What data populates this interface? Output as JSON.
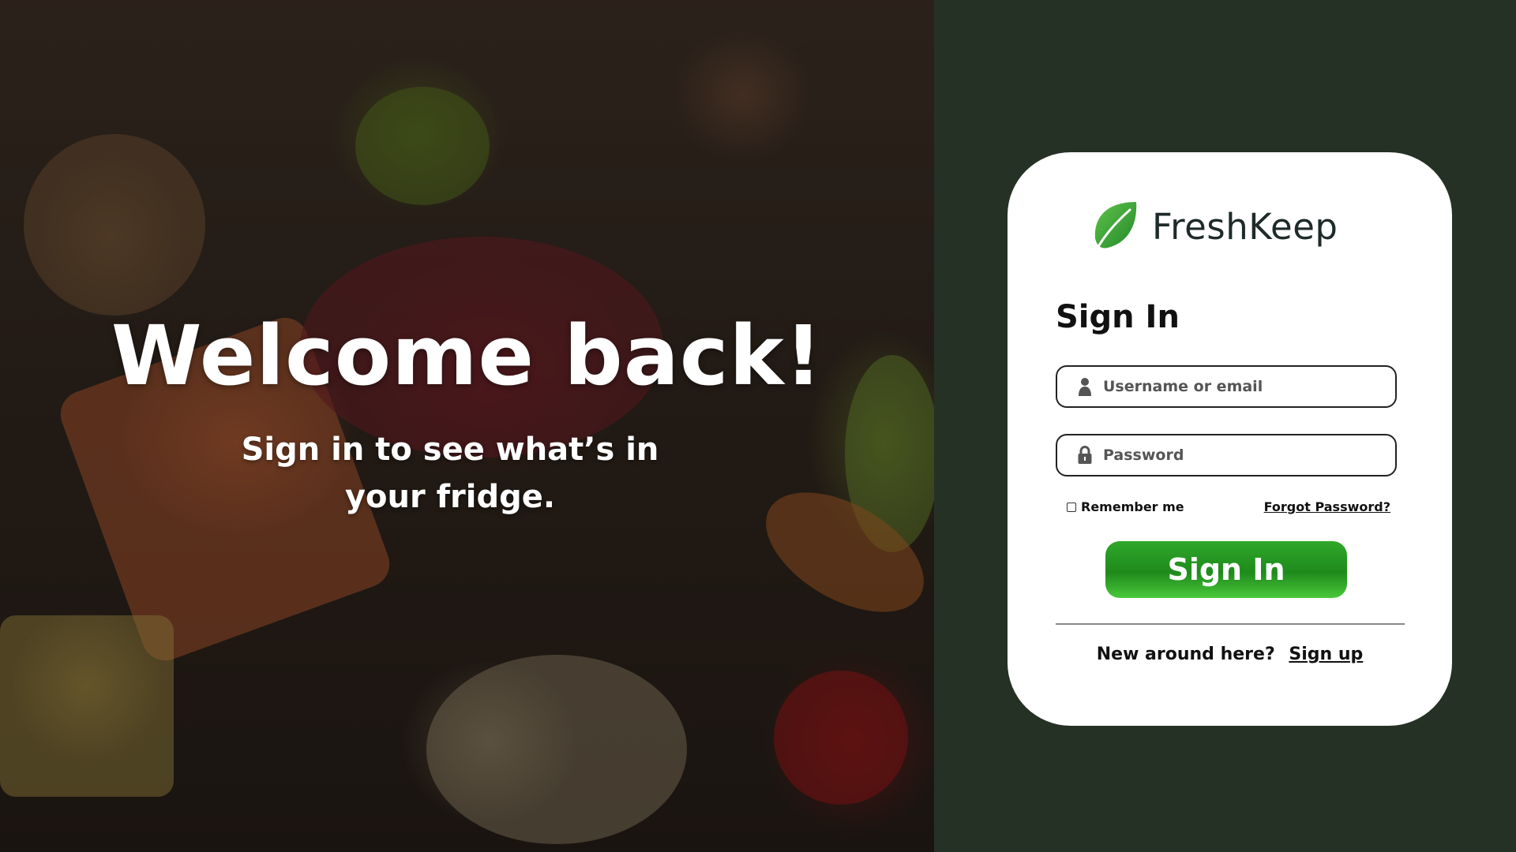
{
  "hero": {
    "headline": "Welcome back!",
    "subtitle": "Sign in to see what’s in your fridge."
  },
  "brand": {
    "name": "FreshKeep",
    "logo_icon": "leaf-icon",
    "accent_color": "#2fa72a"
  },
  "form": {
    "title": "Sign In",
    "username_placeholder": "Username or email",
    "username_icon": "user-icon",
    "password_placeholder": "Password",
    "password_icon": "lock-icon",
    "remember_label": "Remember me",
    "remember_checked": false,
    "forgot_label": "Forgot Password?",
    "submit_label": "Sign In",
    "signup_prompt": "New around here?",
    "signup_label": "Sign up"
  },
  "colors": {
    "page_background": "#263126",
    "card_background": "#ffffff",
    "button_green": "#2fa72a"
  }
}
